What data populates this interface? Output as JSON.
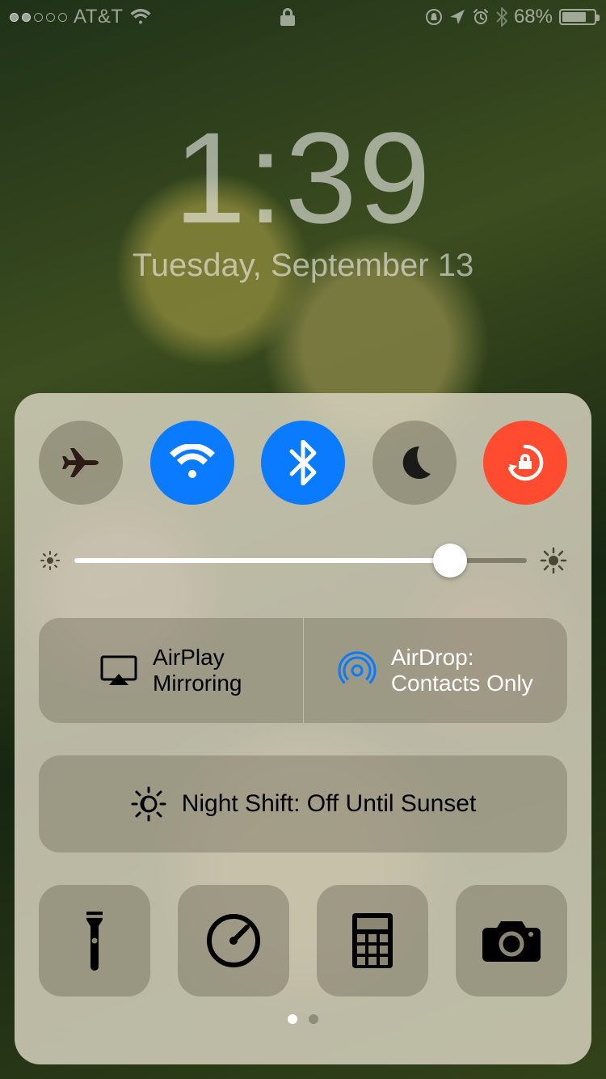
{
  "status_bar": {
    "signal_filled": 2,
    "signal_total": 5,
    "carrier": "AT&T",
    "battery_percent": "68%"
  },
  "lock_screen": {
    "time": "1:39",
    "date": "Tuesday, September 13"
  },
  "control_center": {
    "toggles": {
      "airplane": {
        "active": false
      },
      "wifi": {
        "active": true
      },
      "bluetooth": {
        "active": true
      },
      "dnd": {
        "active": false
      },
      "rotation_lock": {
        "active": true
      }
    },
    "brightness_percent": 83,
    "airplay": {
      "line1": "AirPlay",
      "line2": "Mirroring"
    },
    "airdrop": {
      "line1": "AirDrop:",
      "line2": "Contacts Only"
    },
    "night_shift": "Night Shift: Off Until Sunset",
    "pages": {
      "count": 2,
      "active_index": 0
    }
  },
  "colors": {
    "active_blue": "#0a7aff",
    "active_orange": "#ff4b30"
  }
}
